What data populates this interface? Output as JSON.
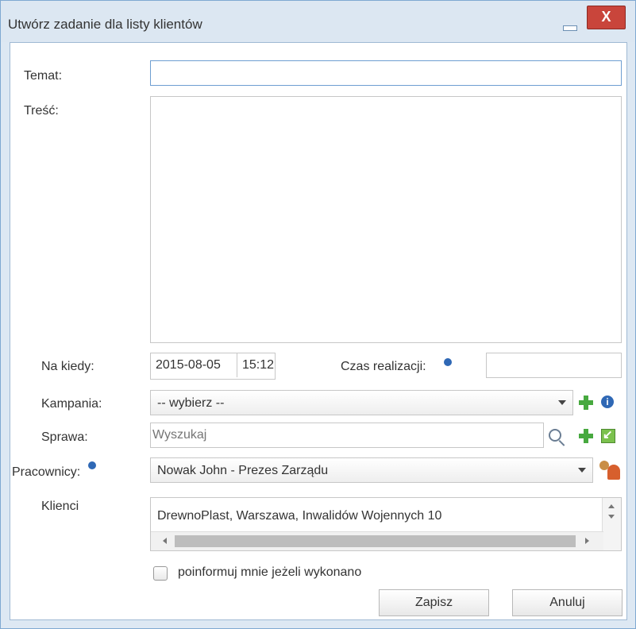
{
  "window": {
    "title": "Utwórz zadanie dla listy klientów",
    "close_symbol": "X"
  },
  "form": {
    "temat_label": "Temat:",
    "tresc_label": "Treść:",
    "na_kiedy_label": "Na kiedy:",
    "date_value": "2015-08-05",
    "time_value": "15:12",
    "czas_realizacji_label": "Czas realizacji:",
    "kampania_label": "Kampania:",
    "kampania_value": "-- wybierz --",
    "sprawa_label": "Sprawa:",
    "sprawa_placeholder": "Wyszukaj",
    "pracownicy_label": "Pracownicy:",
    "pracownicy_value": "Nowak John - Prezes Zarządu",
    "klienci_label": "Klienci",
    "klienci_value": "DrewnoPlast, Warszawa, Inwalidów Wojennych 10",
    "checkbox_label": "poinformuj mnie jeżeli wykonano"
  },
  "buttons": {
    "save": "Zapisz",
    "cancel": "Anuluj"
  },
  "icons": {
    "info": "info-icon",
    "add": "plus-icon",
    "search": "search-icon",
    "export": "export-icon",
    "people": "people-icon"
  }
}
